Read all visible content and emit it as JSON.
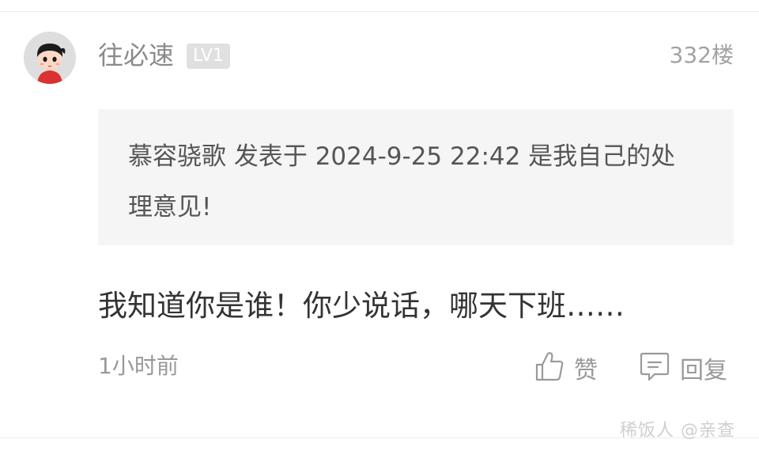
{
  "user": {
    "name": "往必速",
    "level": "LV1"
  },
  "floor": "332楼",
  "quote": {
    "text": "慕容骁歌 发表于 2024-9-25 22:42 是我自己的处理意见!"
  },
  "comment": {
    "text": "我知道你是谁！你少说话，哪天下班……"
  },
  "meta": {
    "time": "1小时前"
  },
  "actions": {
    "like_label": "赞",
    "reply_label": "回复"
  },
  "watermark": "稀饭人 @亲查",
  "icons": {
    "like": "thumbs-up-icon",
    "reply": "comment-icon"
  }
}
